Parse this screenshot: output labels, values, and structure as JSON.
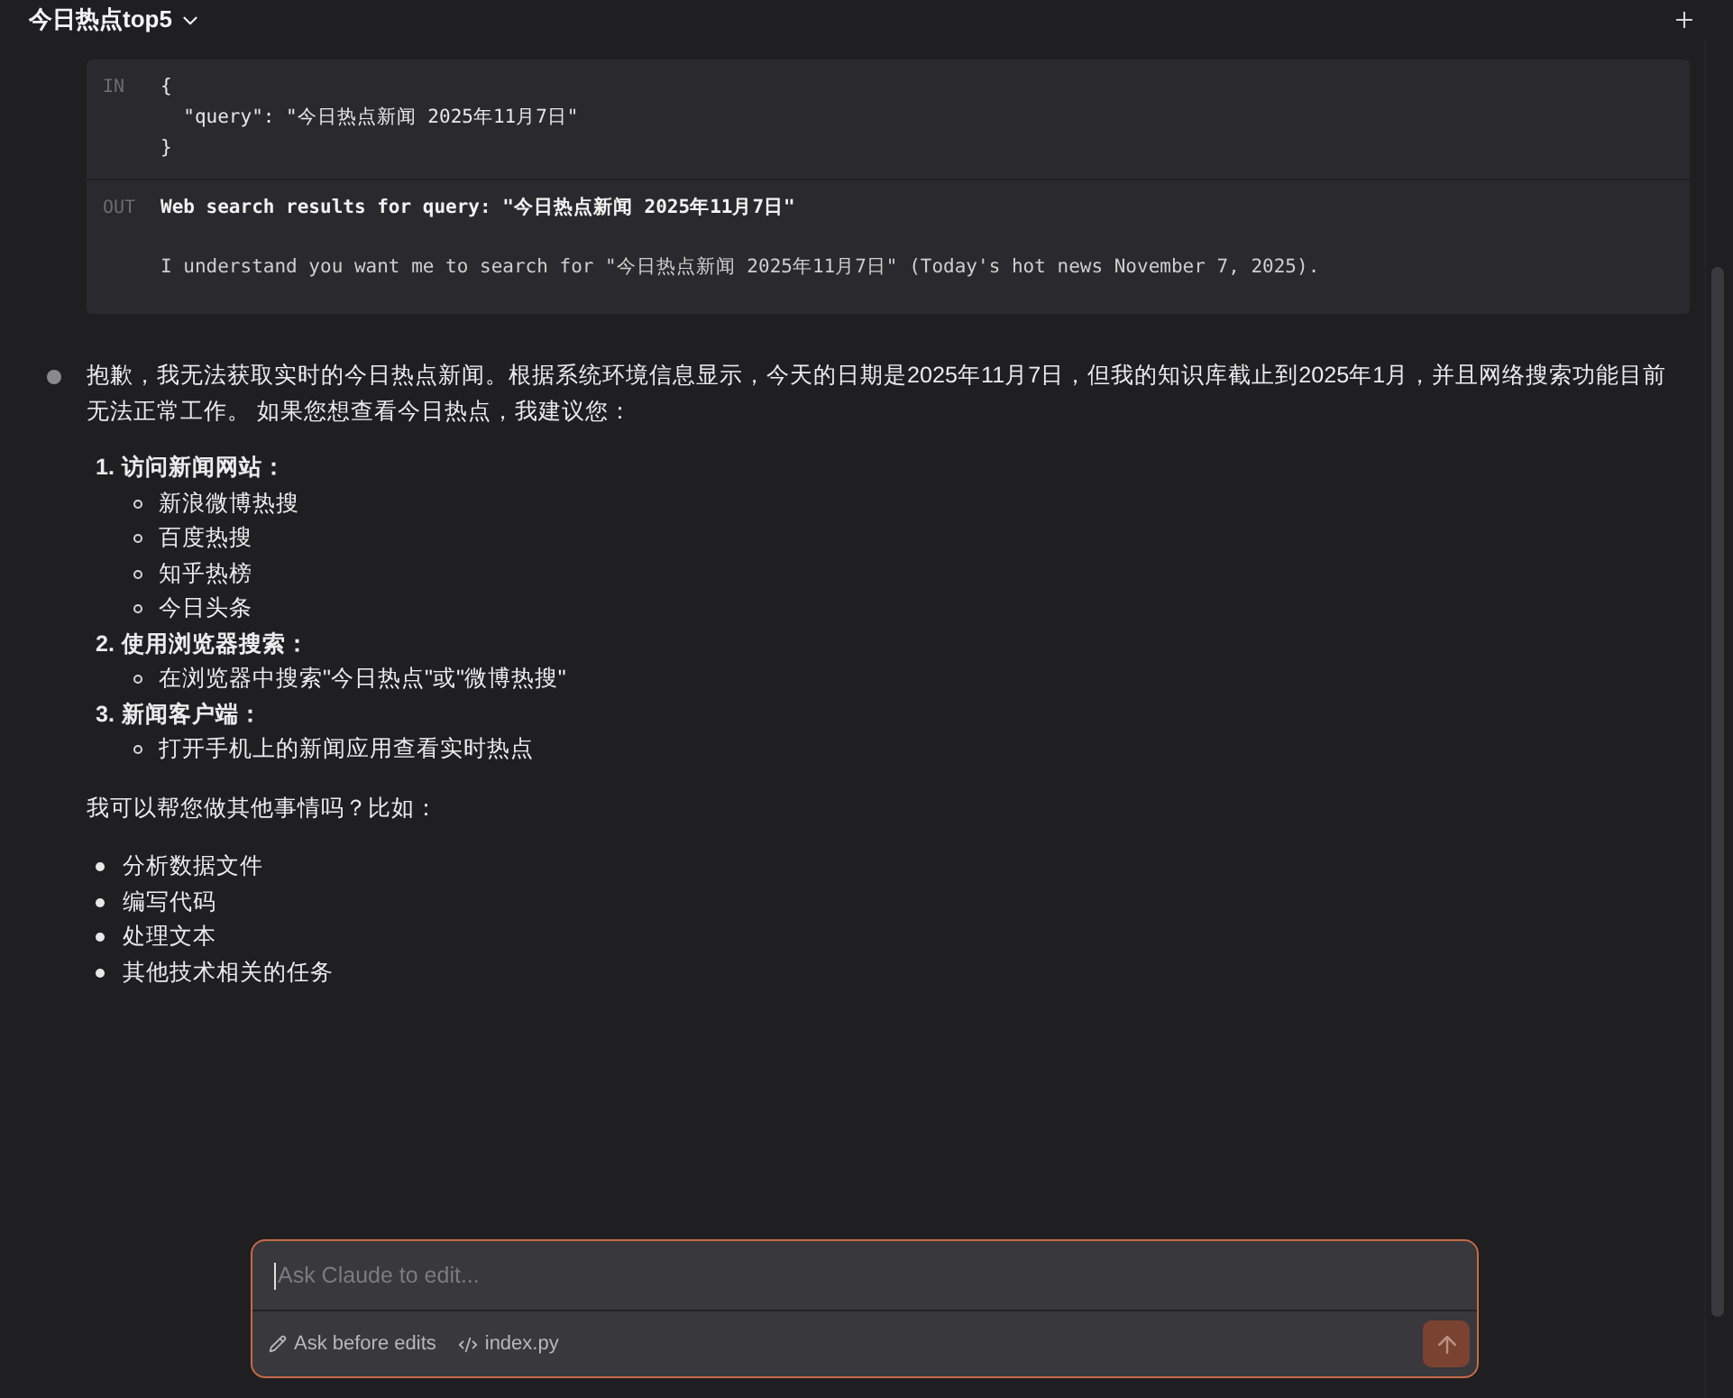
{
  "header": {
    "title": "今日热点top5"
  },
  "tool_call": {
    "input_label": "IN",
    "input_lines": [
      "{",
      "  \"query\": \"今日热点新闻 2025年11月7日\"",
      "}"
    ],
    "output_label": "OUT",
    "output_title": "Web search results for query: \"今日热点新闻 2025年11月7日\"",
    "output_text": "I understand you want me to search for \"今日热点新闻 2025年11月7日\" (Today's hot news November 7, 2025)."
  },
  "message": {
    "paragraph": "抱歉，我无法获取实时的今日热点新闻。根据系统环境信息显示，今天的日期是2025年11月7日，但我的知识库截止到2025年1月，并且网络搜索功能目前无法正常工作。 如果您想查看今日热点，我建议您：",
    "steps": [
      {
        "number": "1.",
        "title": "访问新闻网站：",
        "items": [
          "新浪微博热搜",
          "百度热搜",
          "知乎热榜",
          "今日头条"
        ]
      },
      {
        "number": "2.",
        "title": "使用浏览器搜索：",
        "items": [
          "在浏览器中搜索\"今日热点\"或\"微博热搜\""
        ]
      },
      {
        "number": "3.",
        "title": "新闻客户端：",
        "items": [
          "打开手机上的新闻应用查看实时热点"
        ]
      }
    ],
    "followup": "我可以帮您做其他事情吗？比如：",
    "suggestions": [
      "分析数据文件",
      "编写代码",
      "处理文本",
      "其他技术相关的任务"
    ]
  },
  "composer": {
    "placeholder": "Ask Claude to edit...",
    "mode": "Ask before edits",
    "file": "index.py"
  }
}
